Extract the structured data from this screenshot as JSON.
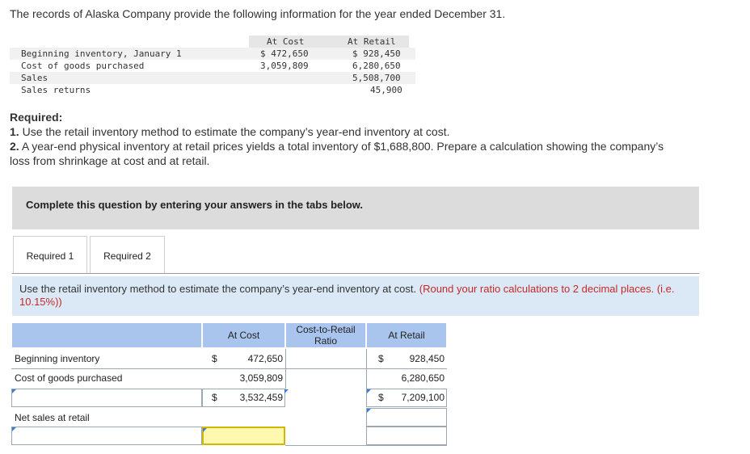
{
  "intro": "The records of Alaska Company provide the following information for the year ended December 31.",
  "given": {
    "headers": {
      "cost": "At Cost",
      "retail": "At Retail"
    },
    "rows": [
      {
        "label": "Beginning inventory, January 1",
        "cost": "$ 472,650",
        "retail": "$ 928,450"
      },
      {
        "label": "Cost of goods purchased",
        "cost": "3,059,809",
        "retail": "6,280,650"
      },
      {
        "label": "Sales",
        "cost": "",
        "retail": "5,508,700"
      },
      {
        "label": "Sales returns",
        "cost": "",
        "retail": "45,900"
      }
    ]
  },
  "required": {
    "title": "Required:",
    "item1_num": "1.",
    "item1": "Use the retail inventory method to estimate the company’s year-end inventory at cost.",
    "item2_num": "2.",
    "item2_a": "A year-end physical inventory at retail prices yields a total inventory of $1,688,800. Prepare a calculation showing the company’s",
    "item2_b": "loss from shrinkage at cost and at retail."
  },
  "banner": "Complete this question by entering your answers in the tabs below.",
  "tabs": [
    {
      "label": "Required 1"
    },
    {
      "label": "Required 2"
    }
  ],
  "instruction": {
    "text": "Use the retail inventory method to estimate the company’s year-end inventory at cost.",
    "hint": "(Round your ratio calculations to 2 decimal places. (i.e. 10.15%))"
  },
  "worksheet": {
    "headers": {
      "cost": "At Cost",
      "ratio": "Cost-to-Retail Ratio",
      "retail": "At Retail"
    },
    "rows": {
      "beginning": {
        "label": "Beginning inventory",
        "cost_sign": "$",
        "cost": "472,650",
        "retail_sign": "$",
        "retail": "928,450"
      },
      "purchased": {
        "label": "Cost of goods purchased",
        "cost": "3,059,809",
        "retail": "6,280,650"
      },
      "total": {
        "label": "",
        "cost_sign": "$",
        "cost": "3,532,459",
        "retail_sign": "$",
        "retail": "7,209,100"
      },
      "net_sales": {
        "label": "Net sales at retail"
      }
    }
  },
  "colors": {
    "header_blue": "#a9c5ee",
    "instruction_bg": "#dbe9f7",
    "hint_red": "#c62828",
    "input_yellow": "#fff9b0"
  }
}
